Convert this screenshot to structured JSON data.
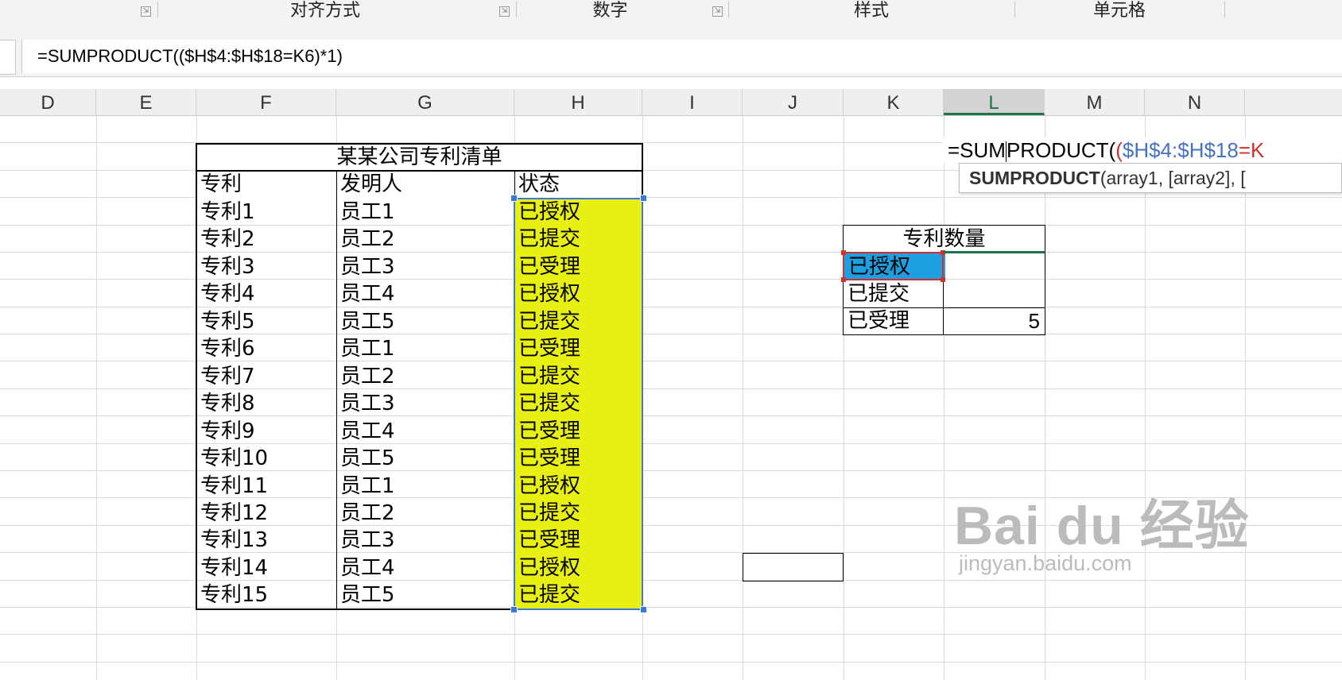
{
  "ribbon": {
    "groups": [
      "对齐方式",
      "数字",
      "样式",
      "单元格"
    ]
  },
  "formula_bar": {
    "formula": "=SUMPRODUCT(($H$4:$H$18=K6)*1)"
  },
  "columns": [
    "D",
    "E",
    "F",
    "G",
    "H",
    "I",
    "J",
    "K",
    "L",
    "M",
    "N"
  ],
  "selected_column": "L",
  "patent_table": {
    "title": "某某公司专利清单",
    "headers": [
      "专利",
      "发明人",
      "状态"
    ],
    "rows": [
      [
        "专利1",
        "员工1",
        "已授权"
      ],
      [
        "专利2",
        "员工2",
        "已提交"
      ],
      [
        "专利3",
        "员工3",
        "已受理"
      ],
      [
        "专利4",
        "员工4",
        "已授权"
      ],
      [
        "专利5",
        "员工5",
        "已提交"
      ],
      [
        "专利6",
        "员工1",
        "已受理"
      ],
      [
        "专利7",
        "员工2",
        "已提交"
      ],
      [
        "专利8",
        "员工3",
        "已提交"
      ],
      [
        "专利9",
        "员工4",
        "已受理"
      ],
      [
        "专利10",
        "员工5",
        "已受理"
      ],
      [
        "专利11",
        "员工1",
        "已授权"
      ],
      [
        "专利12",
        "员工2",
        "已提交"
      ],
      [
        "专利13",
        "员工3",
        "已受理"
      ],
      [
        "专利14",
        "员工4",
        "已授权"
      ],
      [
        "专利15",
        "员工5",
        "已提交"
      ]
    ],
    "status_fill_color": "#e8ef12"
  },
  "summary_table": {
    "title": "专利数量",
    "labels": [
      "已授权",
      "已提交",
      "已受理"
    ],
    "values": [
      "",
      "",
      "5"
    ]
  },
  "editing": {
    "part1": "=SUM",
    "part2": "PRODUCT(",
    "part3": "(",
    "part4": "$H$4:$H$18",
    "part5": "=K"
  },
  "tooltip": {
    "function": "SUMPRODUCT",
    "args": "(array1, [array2], ["
  },
  "watermark": {
    "logo": "Bai du 经验",
    "url": "jingyan.baidu.com"
  },
  "colors": {
    "selection_blue": "#3c78d8",
    "active_cell_fill": "#1e9fdf",
    "ref_blue": "#4472c4",
    "ref_red": "#d03030",
    "header_green": "#217346"
  }
}
